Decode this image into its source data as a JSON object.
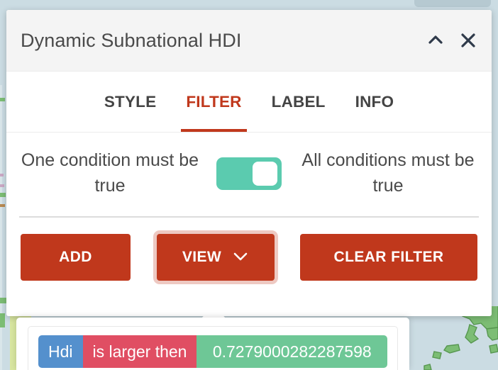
{
  "window": {
    "title": "Dynamic Subnational HDI",
    "collapse_icon": "chevron-up-icon",
    "close_icon": "close-icon"
  },
  "tabs": [
    {
      "label": "STYLE",
      "active": false
    },
    {
      "label": "FILTER",
      "active": true
    },
    {
      "label": "LABEL",
      "active": false
    },
    {
      "label": "INFO",
      "active": false
    }
  ],
  "filter_mode": {
    "left_label": "One condition must be true",
    "right_label": "All conditions must be true",
    "toggle_state": "all",
    "toggle_color": "#5bcbaf"
  },
  "actions": {
    "add_label": "ADD",
    "view_label": "VIEW",
    "view_caret_icon": "chevron-down-icon",
    "clear_label": "CLEAR FILTER",
    "button_color": "#c0381c",
    "focused": "view"
  },
  "filter_popup": {
    "condition": {
      "field": "Hdi",
      "operator": "is larger then",
      "value": "0.7279000282287598",
      "field_color": "#5490cd",
      "operator_color": "#e04e63",
      "value_color": "#6ec796"
    }
  },
  "map": {
    "water_color": "#cbdce3",
    "land_color": "#6cb067",
    "land_fill": "#7cbd74",
    "highlight_color": "#d8e6a0"
  }
}
